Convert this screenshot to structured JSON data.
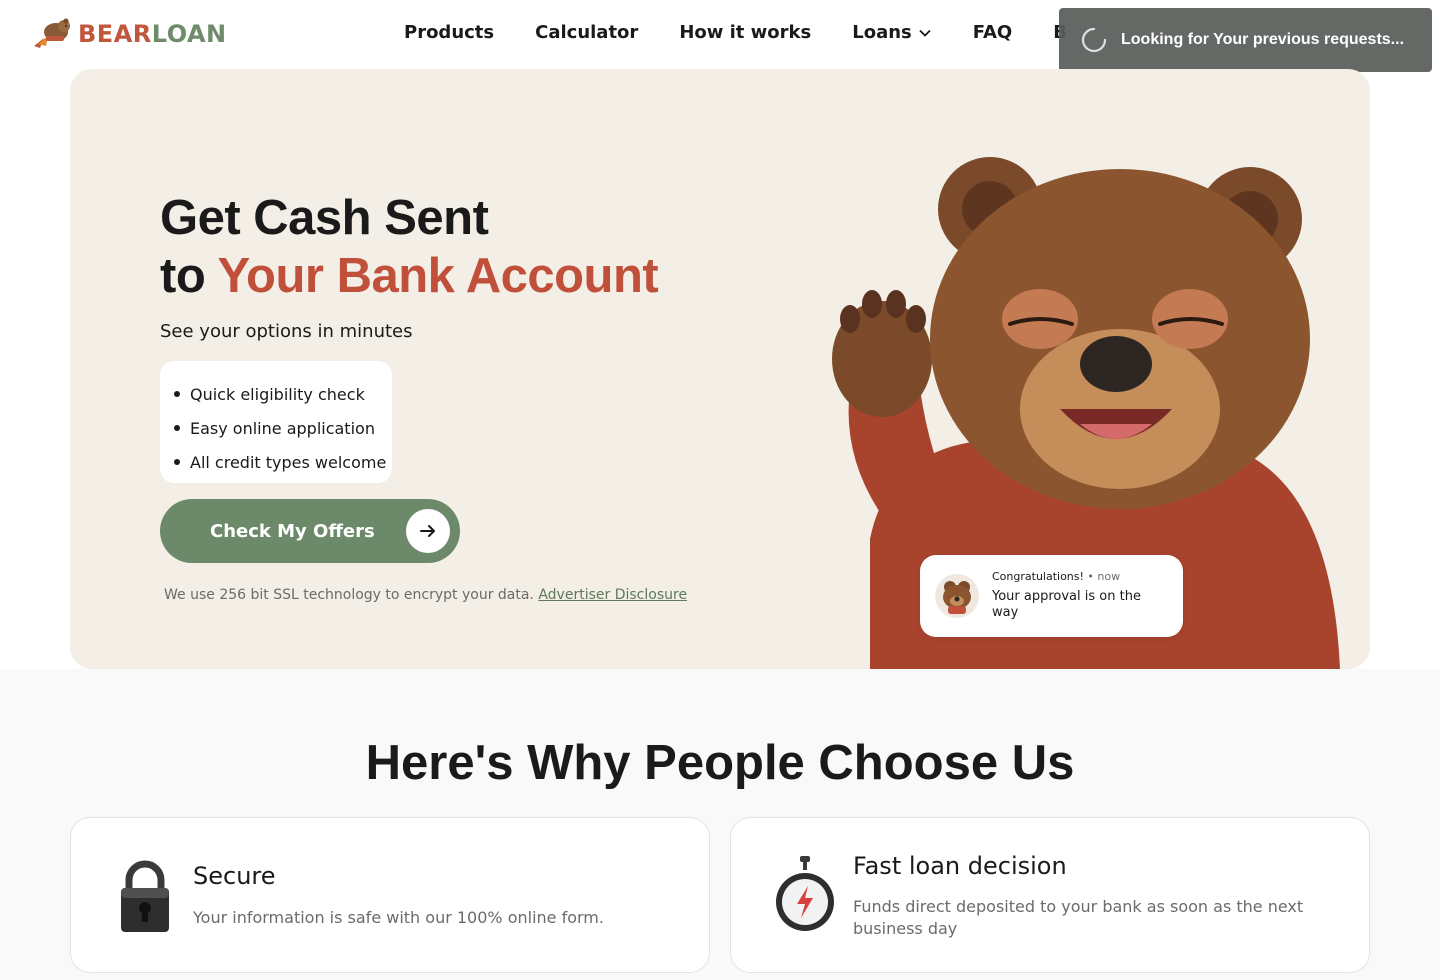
{
  "brand": {
    "part1": "BEAR",
    "part2": "LOAN"
  },
  "nav": [
    {
      "label": "Products"
    },
    {
      "label": "Calculator"
    },
    {
      "label": "How it works"
    },
    {
      "label": "Loans",
      "has_dropdown": true
    },
    {
      "label": "FAQ"
    },
    {
      "label": "B"
    }
  ],
  "toast": {
    "text": "Looking for Your previous requests..."
  },
  "hero": {
    "title_line1": "Get Cash Sent",
    "title_line2_prefix": "to ",
    "title_line2_accent": "Your Bank Account",
    "subtitle": "See your options in minutes",
    "bullets": [
      "Quick eligibility check",
      "Easy online application",
      "All credit types welcome"
    ],
    "cta_label": "Check My Offers",
    "ssl_text": "We use 256 bit SSL technology to encrypt your data.",
    "disclosure_link": "Advertiser Disclosure"
  },
  "notification": {
    "title": "Congratulations! ",
    "separator": " • ",
    "time": "now",
    "message": "Your approval is on the way"
  },
  "why": {
    "title": "Here's Why People Choose Us",
    "cards": [
      {
        "icon": "lock-icon",
        "title": "Secure",
        "text": "Your information is safe with our 100% online form."
      },
      {
        "icon": "stopwatch-icon",
        "title": "Fast loan decision",
        "text": "Funds direct deposited to your bank as soon as the next business day"
      }
    ]
  },
  "colors": {
    "accent": "#c0503a",
    "green": "#6c8a69",
    "hero_bg": "#f3eee6"
  }
}
